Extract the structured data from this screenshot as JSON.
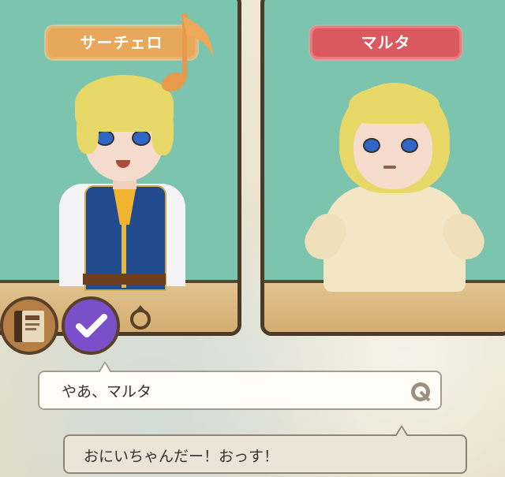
{
  "characters": {
    "left": {
      "name": "サーチェロ",
      "tag_color": "#e8a85b"
    },
    "right": {
      "name": "マルタ",
      "tag_color": "#d9595f"
    }
  },
  "dialogue": {
    "line_1": "やあ、マルタ",
    "line_2": "おにいちゃんだー！おっす！"
  },
  "icons": {
    "menu_book": "book-icon",
    "confirm": "checkmark-icon",
    "ring": "ring-icon",
    "music": "music-note-icon",
    "advance": "advance-icon"
  }
}
